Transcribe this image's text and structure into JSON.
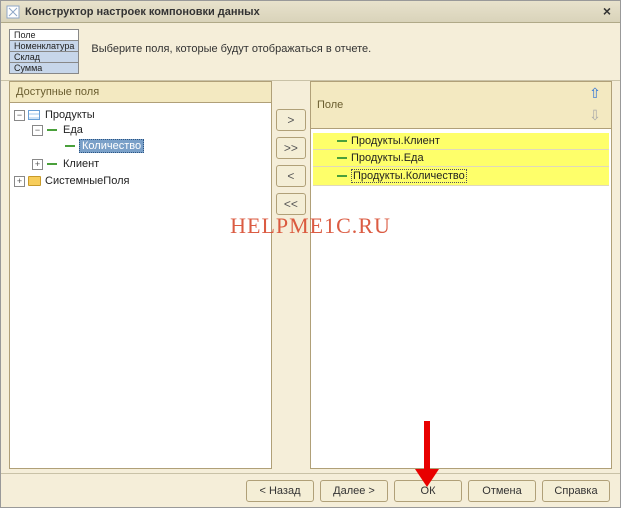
{
  "title": "Конструктор настроек компоновки данных",
  "legend": {
    "r0": "Поле",
    "r1": "Номенклатура",
    "r2": "Склад",
    "r3": "Сумма"
  },
  "hint": "Выберите поля, которые будут отображаться в отчете.",
  "leftHeader": "Доступные поля",
  "rightHeader": "Поле",
  "tree": {
    "n0": "Продукты",
    "n1": "Еда",
    "n2": "Количество",
    "n3": "Клиент",
    "n4": "СистемныеПоля"
  },
  "midButtons": {
    "b0": ">",
    "b1": ">>",
    "b2": "<",
    "b3": "<<"
  },
  "list": {
    "i0": "Продукты.Клиент",
    "i1": "Продукты.Еда",
    "i2": "Продукты.Количество"
  },
  "arrowUp": "⇧",
  "arrowDown": "⇩",
  "watermark": "HELPME1C.RU",
  "footer": {
    "back": "< Назад",
    "next": "Далее >",
    "ok": "ОК",
    "cancel": "Отмена",
    "help": "Справка"
  },
  "closeGlyph": "×"
}
